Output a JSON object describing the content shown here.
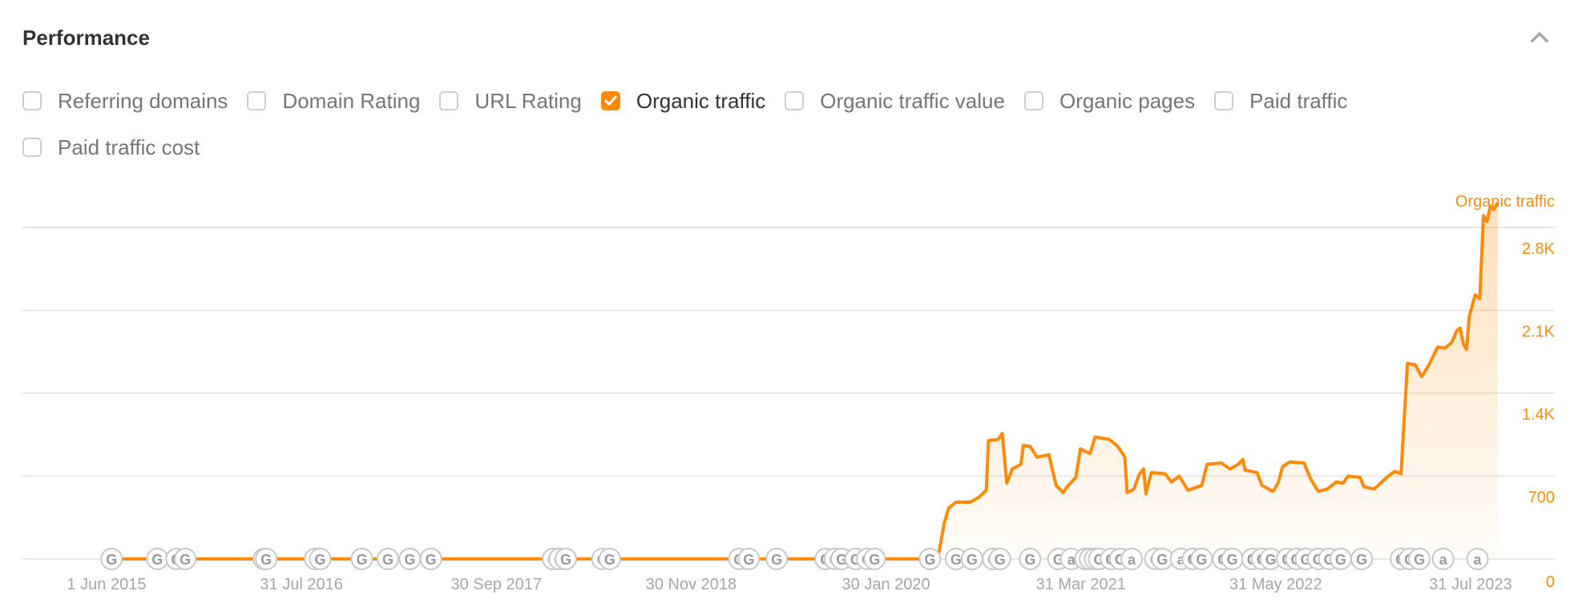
{
  "header": {
    "title": "Performance",
    "collapse_icon": "chevron-up-icon"
  },
  "filters": [
    {
      "label": "Referring domains",
      "checked": false
    },
    {
      "label": "Domain Rating",
      "checked": false
    },
    {
      "label": "URL Rating",
      "checked": false
    },
    {
      "label": "Organic traffic",
      "checked": true
    },
    {
      "label": "Organic traffic value",
      "checked": false
    },
    {
      "label": "Organic pages",
      "checked": false
    },
    {
      "label": "Paid traffic",
      "checked": false
    },
    {
      "label": "Paid traffic cost",
      "checked": false
    }
  ],
  "colors": {
    "accent": "#ff8a0a",
    "grid": "#e8e8e8",
    "tick_text": "#a6a6a6",
    "marker": "#c8c8c8"
  },
  "chart_data": {
    "type": "area",
    "title": "",
    "series": [
      {
        "name": "Organic traffic",
        "points": [
          [
            "2015-06-01",
            0
          ],
          [
            "2016-06-01",
            0
          ],
          [
            "2017-06-01",
            0
          ],
          [
            "2018-06-01",
            0
          ],
          [
            "2019-06-01",
            0
          ],
          [
            "2020-04-20",
            0
          ],
          [
            "2020-05-10",
            20
          ],
          [
            "2020-05-25",
            60
          ],
          [
            "2020-06-05",
            300
          ],
          [
            "2020-06-15",
            430
          ],
          [
            "2020-07-01",
            480
          ],
          [
            "2020-08-01",
            480
          ],
          [
            "2020-08-20",
            520
          ],
          [
            "2020-09-05",
            580
          ],
          [
            "2020-09-10",
            1000
          ],
          [
            "2020-10-01",
            1010
          ],
          [
            "2020-10-10",
            1060
          ],
          [
            "2020-10-20",
            640
          ],
          [
            "2020-11-01",
            760
          ],
          [
            "2020-11-20",
            800
          ],
          [
            "2020-11-25",
            960
          ],
          [
            "2020-12-10",
            950
          ],
          [
            "2020-12-25",
            860
          ],
          [
            "2021-01-20",
            880
          ],
          [
            "2021-02-05",
            620
          ],
          [
            "2021-02-20",
            560
          ],
          [
            "2021-03-01",
            610
          ],
          [
            "2021-03-20",
            690
          ],
          [
            "2021-03-30",
            930
          ],
          [
            "2021-04-20",
            890
          ],
          [
            "2021-05-01",
            1030
          ],
          [
            "2021-06-01",
            1010
          ],
          [
            "2021-06-20",
            950
          ],
          [
            "2021-07-05",
            860
          ],
          [
            "2021-07-10",
            560
          ],
          [
            "2021-07-25",
            590
          ],
          [
            "2021-08-05",
            710
          ],
          [
            "2021-08-15",
            760
          ],
          [
            "2021-08-20",
            550
          ],
          [
            "2021-09-01",
            730
          ],
          [
            "2021-10-01",
            720
          ],
          [
            "2021-10-15",
            650
          ],
          [
            "2021-11-01",
            700
          ],
          [
            "2021-11-20",
            580
          ],
          [
            "2021-12-20",
            620
          ],
          [
            "2022-01-01",
            800
          ],
          [
            "2022-02-01",
            810
          ],
          [
            "2022-02-20",
            760
          ],
          [
            "2022-03-10",
            800
          ],
          [
            "2022-03-20",
            840
          ],
          [
            "2022-03-25",
            750
          ],
          [
            "2022-04-20",
            730
          ],
          [
            "2022-05-01",
            620
          ],
          [
            "2022-05-25",
            570
          ],
          [
            "2022-06-05",
            640
          ],
          [
            "2022-06-15",
            780
          ],
          [
            "2022-07-01",
            820
          ],
          [
            "2022-08-01",
            810
          ],
          [
            "2022-08-15",
            680
          ],
          [
            "2022-09-01",
            570
          ],
          [
            "2022-09-20",
            590
          ],
          [
            "2022-10-10",
            650
          ],
          [
            "2022-10-25",
            640
          ],
          [
            "2022-11-05",
            700
          ],
          [
            "2022-12-01",
            690
          ],
          [
            "2022-12-10",
            610
          ],
          [
            "2023-01-01",
            590
          ],
          [
            "2023-01-15",
            640
          ],
          [
            "2023-02-01",
            700
          ],
          [
            "2023-02-15",
            740
          ],
          [
            "2023-03-01",
            720
          ],
          [
            "2023-03-05",
            1000
          ],
          [
            "2023-03-15",
            1650
          ],
          [
            "2023-04-01",
            1640
          ],
          [
            "2023-04-15",
            1540
          ],
          [
            "2023-05-01",
            1640
          ],
          [
            "2023-05-20",
            1790
          ],
          [
            "2023-06-05",
            1780
          ],
          [
            "2023-06-20",
            1830
          ],
          [
            "2023-07-01",
            1930
          ],
          [
            "2023-07-08",
            1950
          ],
          [
            "2023-07-15",
            1820
          ],
          [
            "2023-07-22",
            1770
          ],
          [
            "2023-07-28",
            2050
          ],
          [
            "2023-08-10",
            2230
          ],
          [
            "2023-08-20",
            2200
          ],
          [
            "2023-08-28",
            2900
          ],
          [
            "2023-09-05",
            2850
          ],
          [
            "2023-09-12",
            2980
          ],
          [
            "2023-09-20",
            2950
          ],
          [
            "2023-09-28",
            3010
          ]
        ]
      }
    ],
    "x_tick_labels": [
      "1 Jun 2015",
      "31 Jul 2016",
      "30 Sep 2017",
      "30 Nov 2018",
      "30 Jan 2020",
      "31 Mar 2021",
      "31 May 2022",
      "31 Jul 2023"
    ],
    "x_ticks": [
      "2015-06-01",
      "2016-07-31",
      "2017-09-30",
      "2018-11-30",
      "2020-01-30",
      "2021-03-31",
      "2022-05-31",
      "2023-07-31"
    ],
    "xrange": [
      "2014-12-01",
      "2024-03-01"
    ],
    "y_axis_title": "Organic traffic",
    "y_tick_labels": [
      "0",
      "700",
      "1.4K",
      "2.1K",
      "2.8K"
    ],
    "y_ticks": [
      0,
      700,
      1400,
      2100,
      2800
    ],
    "ylim": [
      0,
      3100
    ],
    "y_axis_side": "right",
    "grid": true,
    "annotations": {
      "description": "Google algorithm update (G) and Ahrefs update (a) markers along the baseline",
      "markers": [
        {
          "date": "2015-06-12",
          "type": "G"
        },
        {
          "date": "2015-09-20",
          "type": "G"
        },
        {
          "date": "2015-11-01",
          "type": "G"
        },
        {
          "date": "2015-11-20",
          "type": "G"
        },
        {
          "date": "2016-05-10",
          "type": "G"
        },
        {
          "date": "2016-05-15",
          "type": "G"
        },
        {
          "date": "2016-08-30",
          "type": "G"
        },
        {
          "date": "2016-09-10",
          "type": "G"
        },
        {
          "date": "2016-12-10",
          "type": "G"
        },
        {
          "date": "2017-02-05",
          "type": "G"
        },
        {
          "date": "2017-03-25",
          "type": "G"
        },
        {
          "date": "2017-05-10",
          "type": "G"
        },
        {
          "date": "2018-02-01",
          "type": "G"
        },
        {
          "date": "2018-02-15",
          "type": "G"
        },
        {
          "date": "2018-03-01",
          "type": "G"
        },
        {
          "date": "2018-05-20",
          "type": "G"
        },
        {
          "date": "2018-06-05",
          "type": "G"
        },
        {
          "date": "2019-03-15",
          "type": "G"
        },
        {
          "date": "2019-04-05",
          "type": "G"
        },
        {
          "date": "2019-06-05",
          "type": "G"
        },
        {
          "date": "2019-09-20",
          "type": "G"
        },
        {
          "date": "2019-10-10",
          "type": "G"
        },
        {
          "date": "2019-10-25",
          "type": "G"
        },
        {
          "date": "2019-11-25",
          "type": "G"
        },
        {
          "date": "2019-12-20",
          "type": "G"
        },
        {
          "date": "2020-01-05",
          "type": "G"
        },
        {
          "date": "2020-05-05",
          "type": "G"
        },
        {
          "date": "2020-07-01",
          "type": "G"
        },
        {
          "date": "2020-08-05",
          "type": "G"
        },
        {
          "date": "2020-09-20",
          "type": "G"
        },
        {
          "date": "2020-10-05",
          "type": "G"
        },
        {
          "date": "2020-12-10",
          "type": "G"
        },
        {
          "date": "2021-02-10",
          "type": "G"
        },
        {
          "date": "2021-03-10",
          "type": "a"
        },
        {
          "date": "2021-04-10",
          "type": "G"
        },
        {
          "date": "2021-04-20",
          "type": "G"
        },
        {
          "date": "2021-05-01",
          "type": "G"
        },
        {
          "date": "2021-05-10",
          "type": "G"
        },
        {
          "date": "2021-06-05",
          "type": "G"
        },
        {
          "date": "2021-06-25",
          "type": "G"
        },
        {
          "date": "2021-07-20",
          "type": "a"
        },
        {
          "date": "2021-09-10",
          "type": "G"
        },
        {
          "date": "2021-09-25",
          "type": "G"
        },
        {
          "date": "2021-11-05",
          "type": "a"
        },
        {
          "date": "2021-12-01",
          "type": "G"
        },
        {
          "date": "2021-12-20",
          "type": "G"
        },
        {
          "date": "2022-02-05",
          "type": "G"
        },
        {
          "date": "2022-02-25",
          "type": "G"
        },
        {
          "date": "2022-04-10",
          "type": "G"
        },
        {
          "date": "2022-05-01",
          "type": "G"
        },
        {
          "date": "2022-05-20",
          "type": "G"
        },
        {
          "date": "2022-06-25",
          "type": "G"
        },
        {
          "date": "2022-07-15",
          "type": "G"
        },
        {
          "date": "2022-08-05",
          "type": "G"
        },
        {
          "date": "2022-09-01",
          "type": "G"
        },
        {
          "date": "2022-09-25",
          "type": "G"
        },
        {
          "date": "2022-10-20",
          "type": "G"
        },
        {
          "date": "2022-12-05",
          "type": "G"
        },
        {
          "date": "2023-03-01",
          "type": "G"
        },
        {
          "date": "2023-03-20",
          "type": "G"
        },
        {
          "date": "2023-04-10",
          "type": "G"
        },
        {
          "date": "2023-06-01",
          "type": "a"
        },
        {
          "date": "2023-08-15",
          "type": "a"
        }
      ]
    }
  }
}
